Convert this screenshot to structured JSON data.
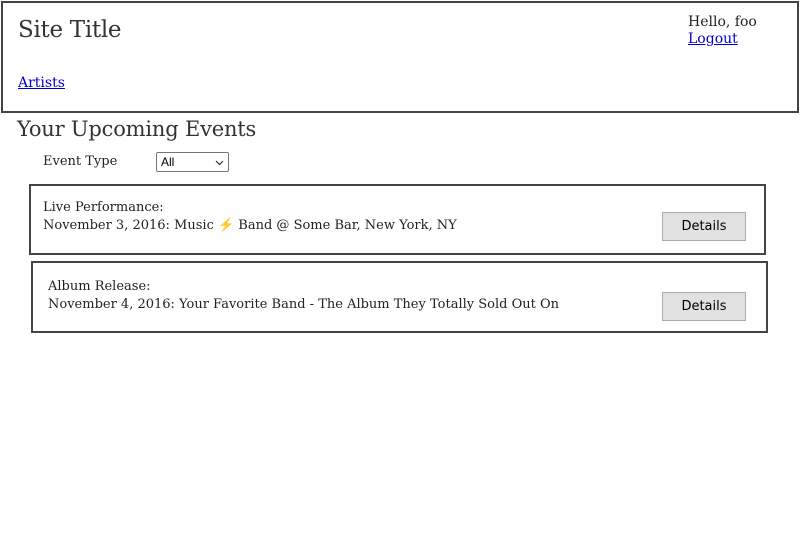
{
  "header": {
    "site_title": "Site Title",
    "nav": [
      {
        "label": "Artists"
      }
    ],
    "user": {
      "greeting": "Hello, foo",
      "logout_label": "Logout"
    }
  },
  "main": {
    "heading": "Your Upcoming Events",
    "filter": {
      "label": "Event Type",
      "selected": "All"
    },
    "events": [
      {
        "type_label": "Live Performance:",
        "description": "November 3, 2016: Music ⚡ Band @ Some Bar, New York, NY",
        "button_label": "Details"
      },
      {
        "type_label": "Album Release:",
        "description": "November 4, 2016: Your Favorite Band - The Album They Totally Sold Out On",
        "button_label": "Details"
      }
    ]
  },
  "colors": {
    "link": "#0000cc",
    "border": "#444444",
    "button_bg": "#e1e1e1"
  }
}
